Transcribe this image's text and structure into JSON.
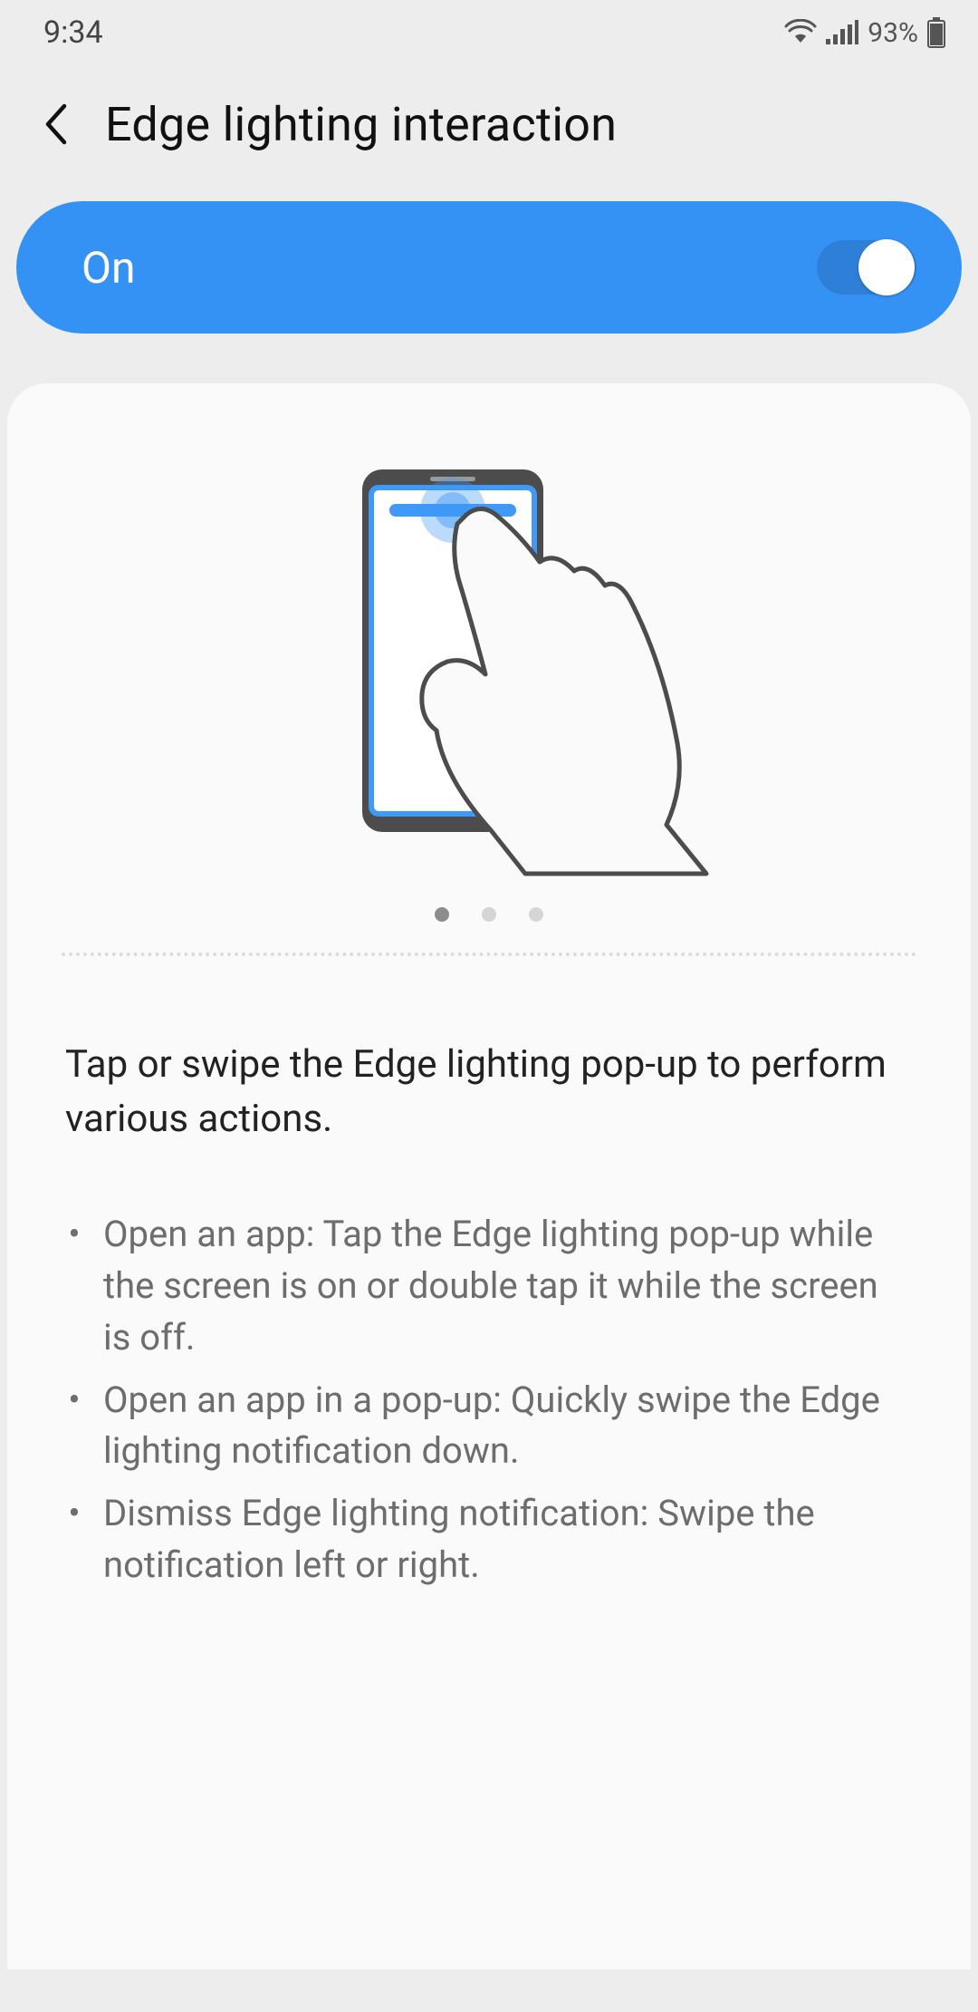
{
  "status": {
    "time": "9:34",
    "battery_pct": "93%"
  },
  "header": {
    "title": "Edge lighting interaction"
  },
  "toggle": {
    "state_label": "On"
  },
  "pager": {
    "count": 3,
    "active_index": 0
  },
  "content": {
    "description": "Tap or swipe the Edge lighting pop-up to perform various actions.",
    "bullets": [
      "Open an app: Tap the Edge lighting pop-up while the screen is on or double tap it while the screen is off.",
      "Open an app in a pop-up: Quickly swipe the Edge lighting notification down.",
      "Dismiss Edge lighting notification: Swipe the notification left or right."
    ]
  },
  "icons": {
    "back": "chevron-left-icon",
    "wifi": "wifi-icon",
    "signal": "signal-icon",
    "battery": "battery-icon"
  }
}
